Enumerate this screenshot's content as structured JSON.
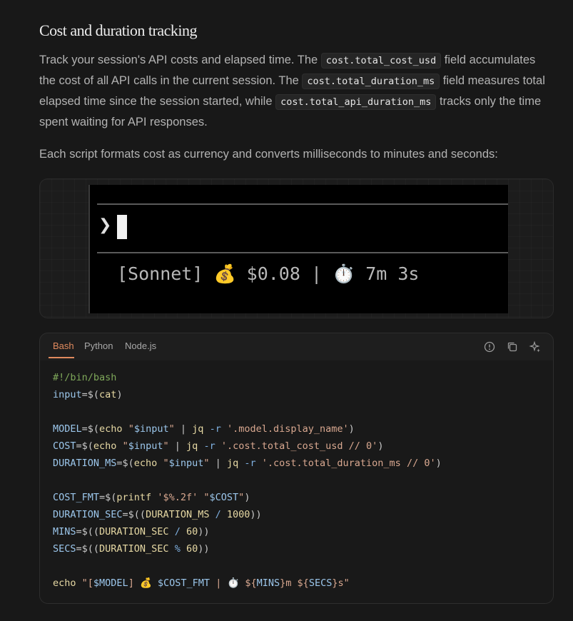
{
  "section": {
    "title": "Cost and duration tracking",
    "p1": {
      "t1": "Track your session's API costs and elapsed time. The ",
      "c1": "cost.total_cost_usd",
      "t2": " field accumulates the cost of all API calls in the current session. The ",
      "c2": "cost.total_duration_ms",
      "t3": " field measures total elapsed time since the session started, while ",
      "c3": "cost.total_api_duration_ms",
      "t4": " tracks only the time spent waiting for API responses."
    },
    "p2": "Each script formats cost as currency and converts milliseconds to minutes and seconds:"
  },
  "terminal": {
    "prompt": "❯",
    "status_line": "[Sonnet] 💰 $0.08 | ⏱️ 7m 3s"
  },
  "code_block": {
    "tabs": [
      "Bash",
      "Python",
      "Node.js"
    ],
    "active_tab": "Bash",
    "accent_color": "#e08a5e",
    "lines": [
      "#!/bin/bash",
      "input=$(cat)",
      "",
      "MODEL=$(echo \"$input\" | jq -r '.model.display_name')",
      "COST=$(echo \"$input\" | jq -r '.cost.total_cost_usd // 0')",
      "DURATION_MS=$(echo \"$input\" | jq -r '.cost.total_duration_ms // 0')",
      "",
      "COST_FMT=$(printf '$%.2f' \"$COST\")",
      "DURATION_SEC=$((DURATION_MS / 1000))",
      "MINS=$((DURATION_SEC / 60))",
      "SECS=$((DURATION_SEC % 60))",
      "",
      "echo \"[$MODEL] 💰 $COST_FMT | ⏱️ ${MINS}m ${SECS}s\""
    ]
  }
}
